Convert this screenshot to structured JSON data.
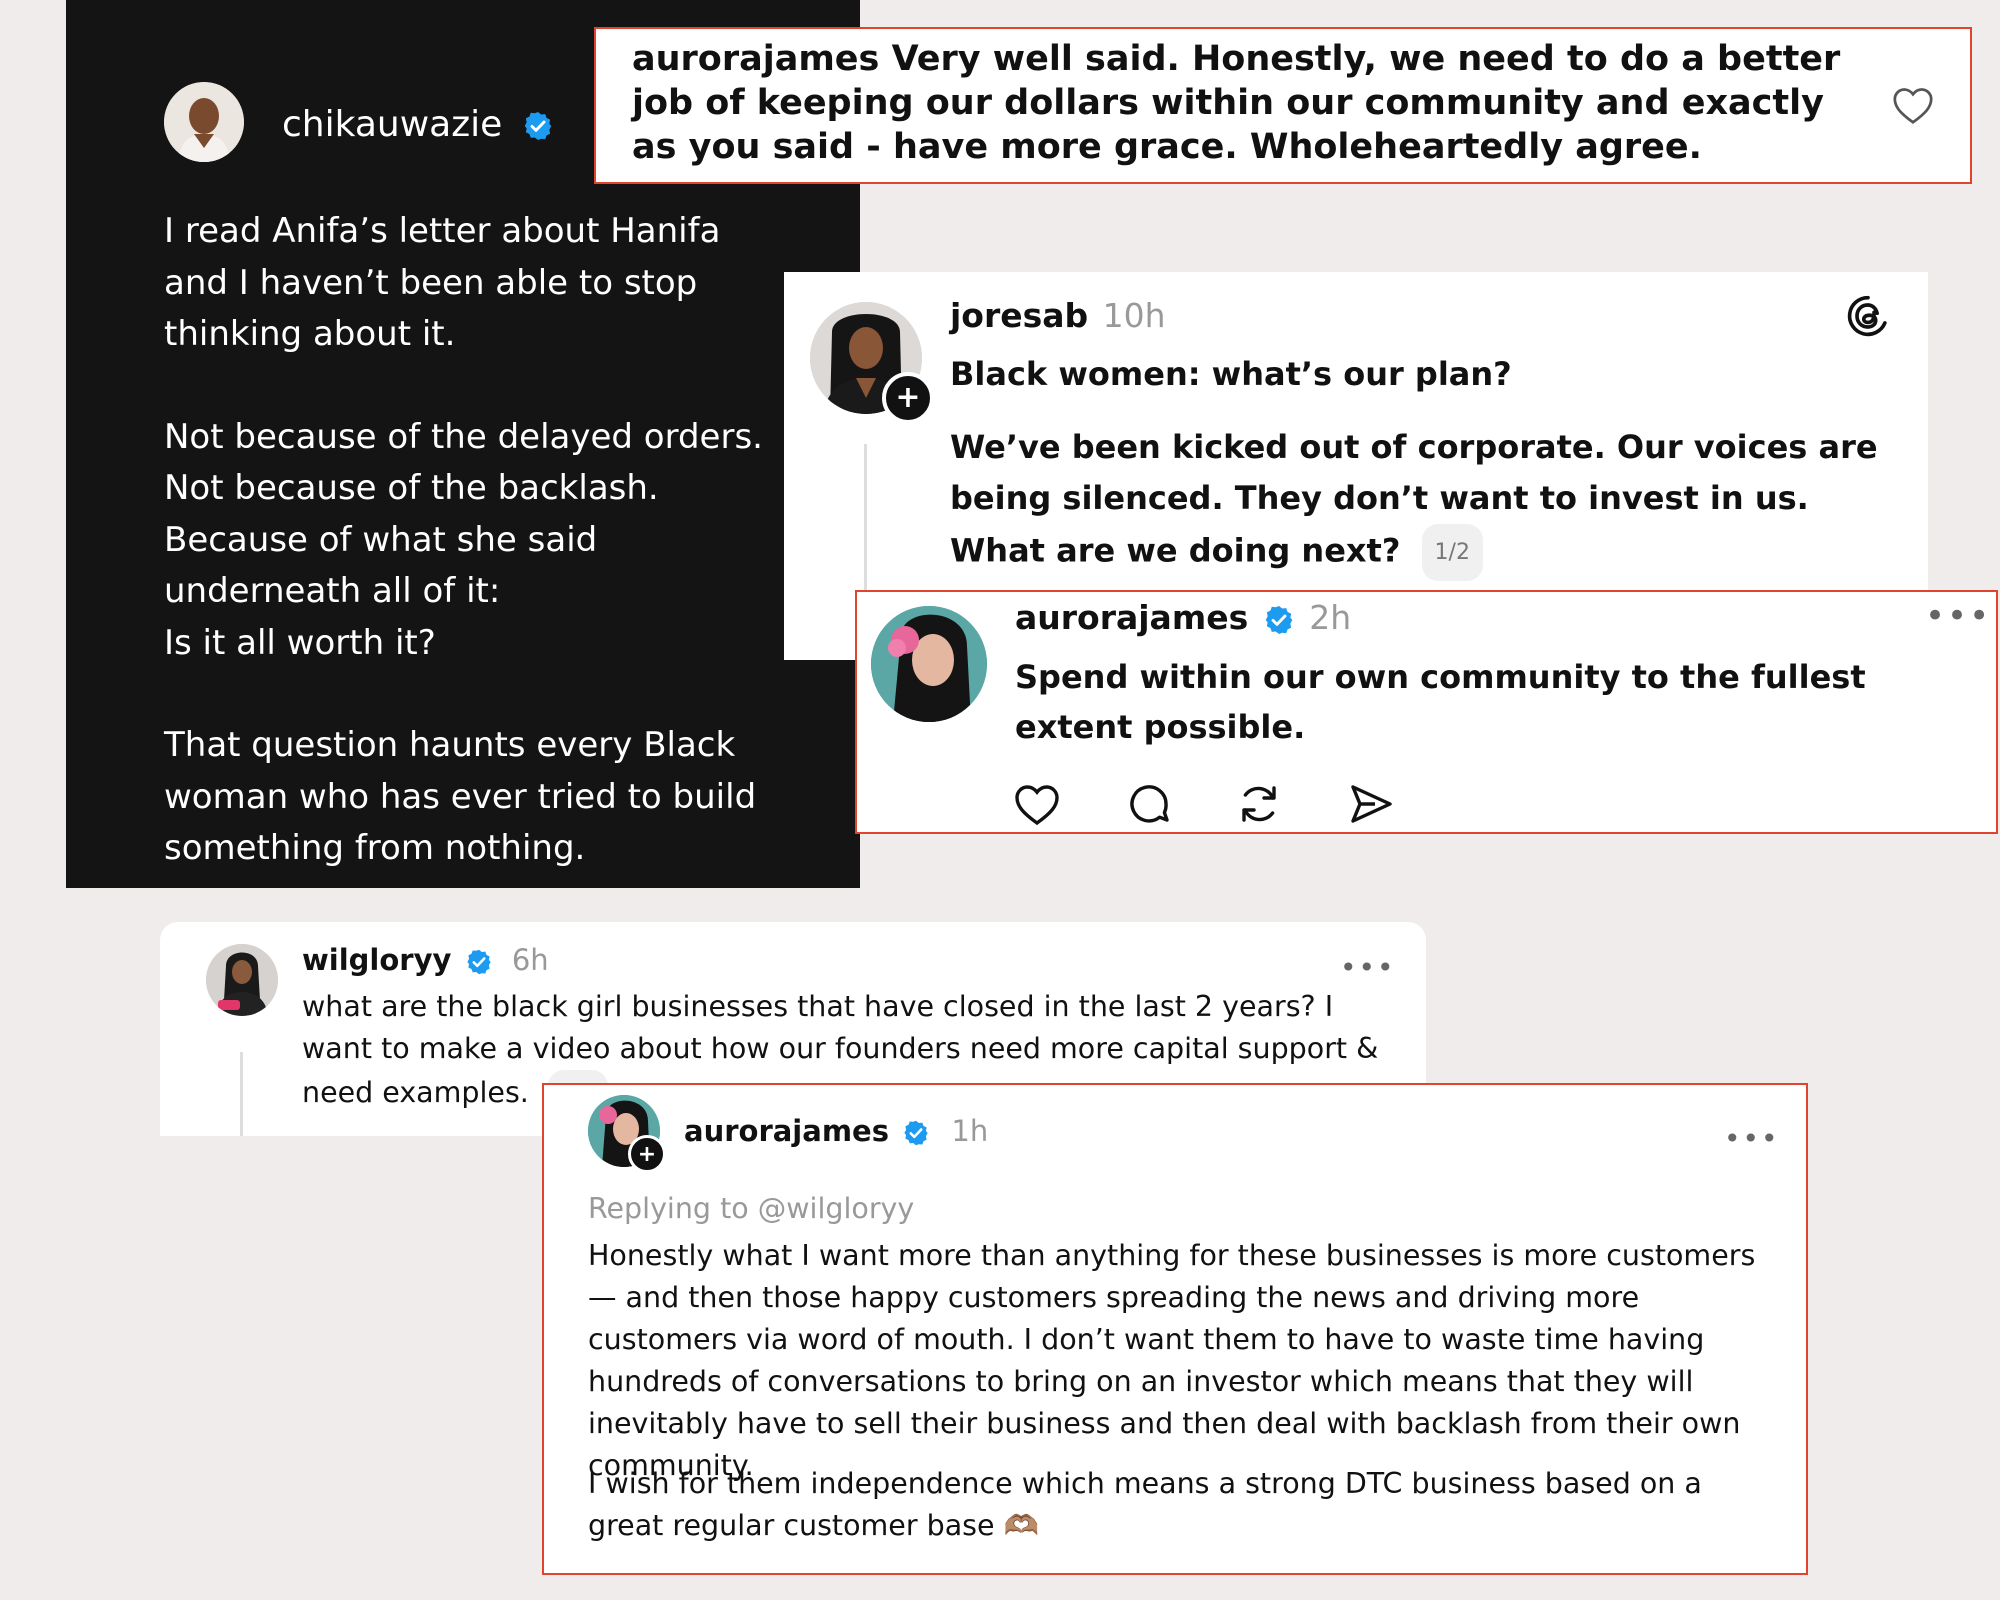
{
  "chika_card": {
    "username": "chikauwazie",
    "paragraphs": [
      "I read Anifa’s letter about Hanifa and I haven’t been able to stop thinking about it.",
      "Not because of the delayed orders.\nNot because of the backlash.\nBecause of what she said underneath all of it:\nIs it all worth it?",
      "That question haunts every Black woman who has ever tried to build something from nothing."
    ]
  },
  "aurora_comment_top": {
    "username": "aurorajames",
    "text": "Very well said. Honestly, we need to do a better job of keeping our dollars within our community and exactly as you said - have more grace. Wholeheartedly agree."
  },
  "joresab_post": {
    "username": "joresab",
    "time": "10h",
    "line1": "Black women: what’s our plan?",
    "body": "We’ve been kicked out of corporate. Our voices are being silenced. They don’t want to invest in us. What are we doing next?",
    "page_indicator": "1/2"
  },
  "aurora_reply_mid": {
    "username": "aurorajames",
    "time": "2h",
    "text": "Spend within our own community to the fullest extent possible."
  },
  "wilgloryy_post": {
    "username": "wilgloryy",
    "time": "6h",
    "text": "what are the black girl businesses that have closed in the last 2 years? I want to make a video about how our founders need more capital support & need examples.",
    "page_indicator": "1/2"
  },
  "aurora_reply_bottom": {
    "username": "aurorajames",
    "time": "1h",
    "replying_to": "Replying to @wilgloryy",
    "paragraph1": "Honestly what I want more than anything for these businesses is more customers — and then those happy customers spreading the news and driving more customers via word of mouth. I don’t want them to have to waste time having hundreds of conversations to bring on an investor which means that they will inevitably have to sell their business and then deal with backlash from their own community.",
    "paragraph2": "I wish for them independence which means a strong DTC business based on a great regular customer base",
    "emoji": "🫶🏽"
  },
  "colors": {
    "verified": "#1d9bf0",
    "highlight_border": "#e1442d",
    "page_background": "#f0ecec"
  }
}
